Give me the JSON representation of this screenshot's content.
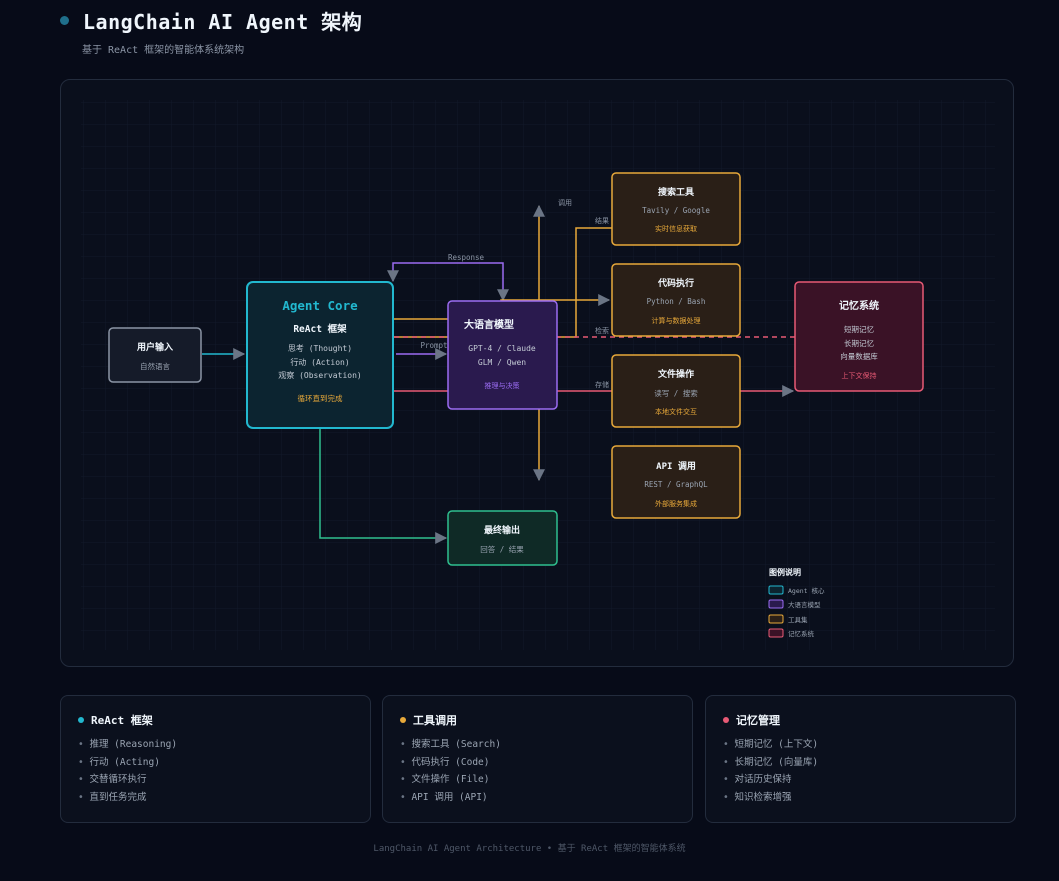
{
  "header": {
    "title": "LangChain AI Agent 架构",
    "subtitle": "基于 ReAct 框架的智能体系统架构"
  },
  "diagram": {
    "user_input": {
      "title": "用户输入",
      "subtitle": "自然语言"
    },
    "agent_core": {
      "title": "Agent Core",
      "framework": "ReAct 框架",
      "lines": [
        "思考 (Thought)",
        "行动 (Action)",
        "观察 (Observation)"
      ],
      "note": "循环直到完成"
    },
    "llm": {
      "title": "大语言模型",
      "lines": [
        "GPT-4 / Claude",
        "GLM / Qwen"
      ],
      "note": "推理与决策"
    },
    "tools": [
      {
        "title": "搜索工具",
        "subtitle": "Tavily / Google",
        "note": "实时信息获取"
      },
      {
        "title": "代码执行",
        "subtitle": "Python / Bash",
        "note": "计算与数据处理"
      },
      {
        "title": "文件操作",
        "subtitle": "读写 / 搜索",
        "note": "本地文件交互"
      },
      {
        "title": "API 调用",
        "subtitle": "REST / GraphQL",
        "note": "外部服务集成"
      }
    ],
    "memory": {
      "title": "记忆系统",
      "lines": [
        "短期记忆",
        "长期记忆",
        "向量数据库"
      ],
      "note": "上下文保持"
    },
    "final_output": {
      "title": "最终输出",
      "subtitle": "回答 / 结果"
    },
    "edge_labels": {
      "response": "Response",
      "prompt": "Prompt",
      "call": "调用",
      "result": "结果",
      "retrieve": "检索",
      "store": "存储"
    },
    "legend": {
      "title": "图例说明",
      "items": [
        {
          "label": "Agent 核心",
          "color": "#22b8cf"
        },
        {
          "label": "大语言模型",
          "color": "#9b6cf2"
        },
        {
          "label": "工具集",
          "color": "#e8a93a"
        },
        {
          "label": "记忆系统",
          "color": "#e85a75"
        }
      ]
    }
  },
  "colors": {
    "agent": "#22b8cf",
    "llm": "#9b6cf2",
    "tool": "#e8a93a",
    "memory": "#e85a75",
    "output": "#2fbf8f",
    "input": "#8b95a5"
  },
  "cards": [
    {
      "title": "ReAct 框架",
      "dot_color": "#22b8cf",
      "items": [
        "推理 (Reasoning)",
        "行动 (Acting)",
        "交替循环执行",
        "直到任务完成"
      ]
    },
    {
      "title": "工具调用",
      "dot_color": "#e8a93a",
      "items": [
        "搜索工具 (Search)",
        "代码执行 (Code)",
        "文件操作 (File)",
        "API 调用 (API)"
      ]
    },
    {
      "title": "记忆管理",
      "dot_color": "#e85a75",
      "items": [
        "短期记忆 (上下文)",
        "长期记忆 (向量库)",
        "对话历史保持",
        "知识检索增强"
      ]
    }
  ],
  "footer": "LangChain AI Agent Architecture • 基于 ReAct 框架的智能体系统"
}
